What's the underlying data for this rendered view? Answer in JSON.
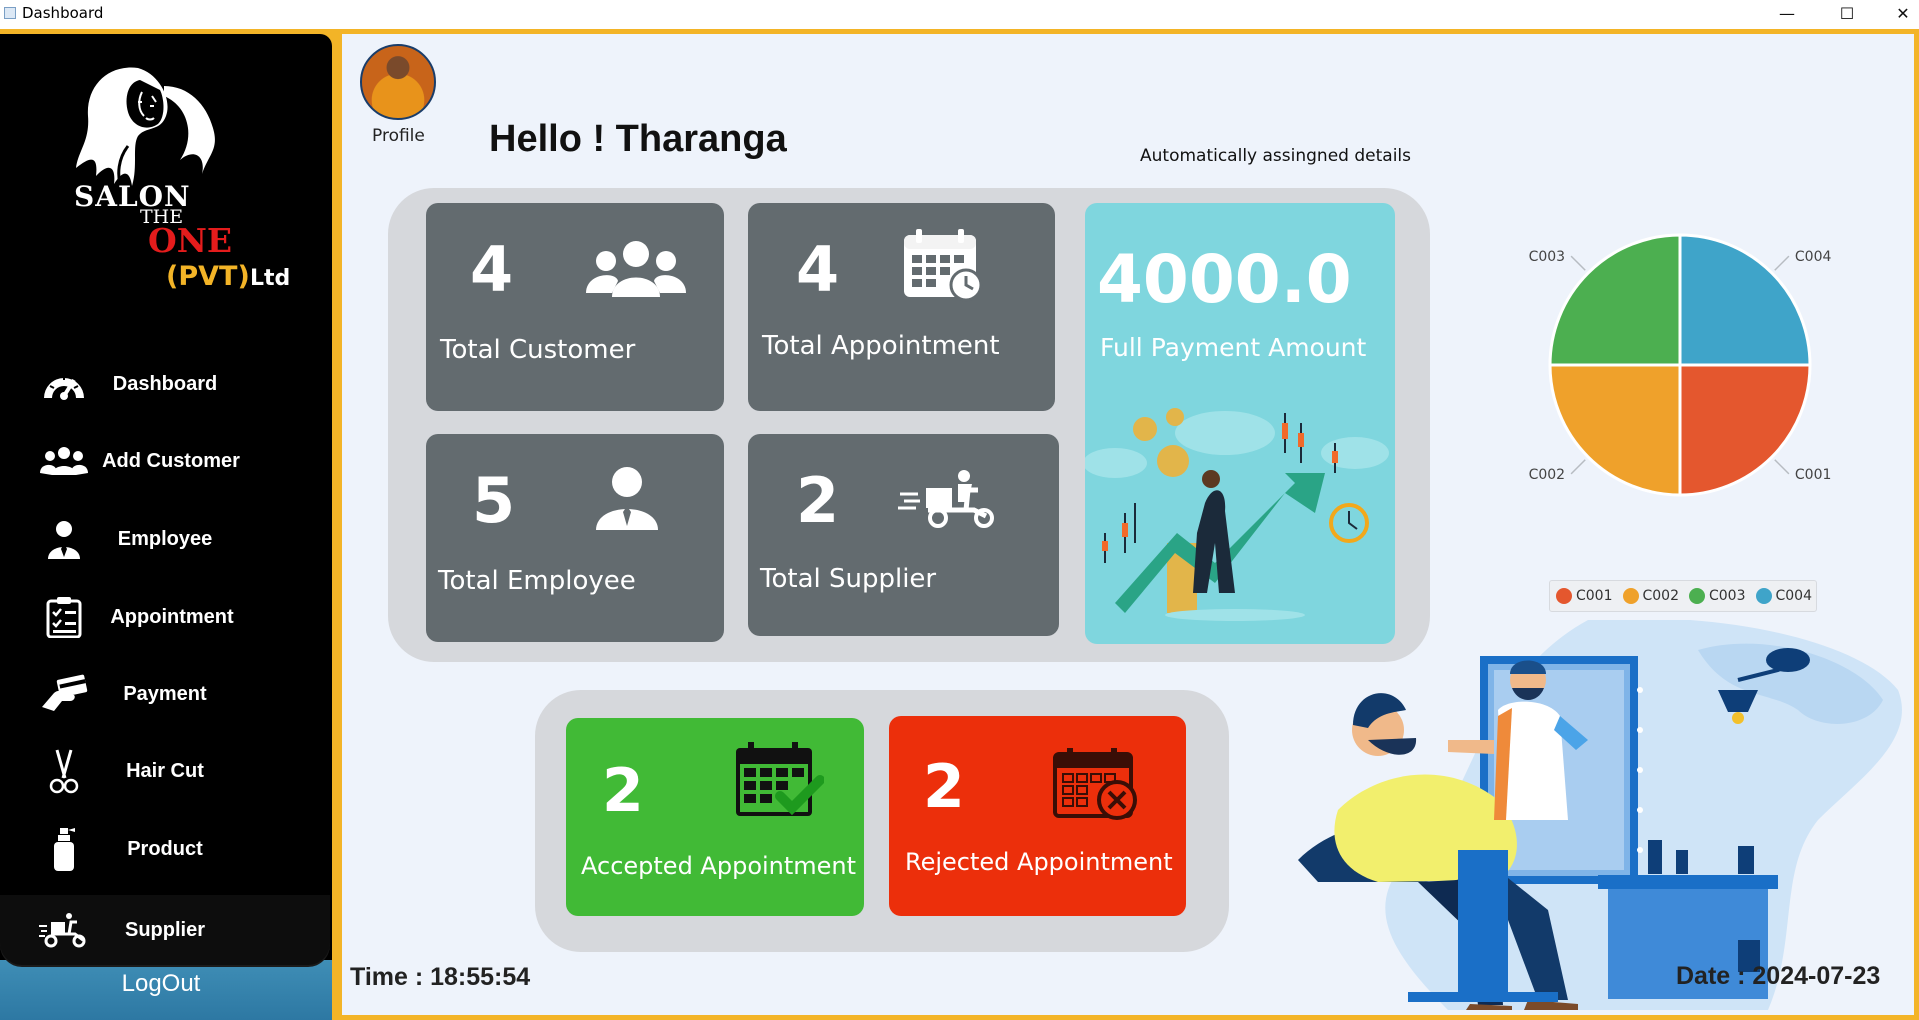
{
  "window": {
    "title": "Dashboard",
    "controls": {
      "minimize": "—",
      "maximize": "☐",
      "close": "✕"
    }
  },
  "sidebar": {
    "logo": {
      "line1": "SALON",
      "line2": "THE",
      "line3": "ONE",
      "line4": "(PVT)",
      "line5": "Ltd"
    },
    "items": [
      {
        "label": "Dashboard",
        "icon": "speedometer-icon"
      },
      {
        "label": "Add Customer",
        "icon": "users-icon"
      },
      {
        "label": "Employee",
        "icon": "employee-icon"
      },
      {
        "label": "Appointment",
        "icon": "clipboard-icon"
      },
      {
        "label": "Payment",
        "icon": "payment-hand-icon"
      },
      {
        "label": "Hair Cut",
        "icon": "scissors-icon"
      },
      {
        "label": "Product",
        "icon": "spray-bottle-icon"
      },
      {
        "label": "Supplier",
        "icon": "delivery-scooter-icon"
      }
    ],
    "logout": "LogOut"
  },
  "header": {
    "profile_label": "Profile",
    "greeting": "Hello ! Tharanga",
    "auto_details": "Automatically assingned details"
  },
  "stats": {
    "customers": {
      "value": "4",
      "label": "Total Customer"
    },
    "appointments": {
      "value": "4",
      "label": "Total Appointment"
    },
    "employees": {
      "value": "5",
      "label": "Total Employee"
    },
    "suppliers": {
      "value": "2",
      "label": "Total Supplier"
    },
    "payment": {
      "value": "4000.0",
      "label": "Full Payment Amount"
    },
    "accepted": {
      "value": "2",
      "label": "Accepted Appointment"
    },
    "rejected": {
      "value": "2",
      "label": "Rejected Appointment"
    }
  },
  "chart_data": {
    "type": "pie",
    "categories": [
      "C001",
      "C002",
      "C003",
      "C004"
    ],
    "values": [
      1,
      1,
      1,
      1
    ],
    "colors": [
      "#e4572e",
      "#efa12b",
      "#4caf50",
      "#3fa4c9"
    ],
    "legend": "bottom"
  },
  "footer": {
    "time": "Time : 18:55:54",
    "date": "Date : 2024-07-23"
  }
}
